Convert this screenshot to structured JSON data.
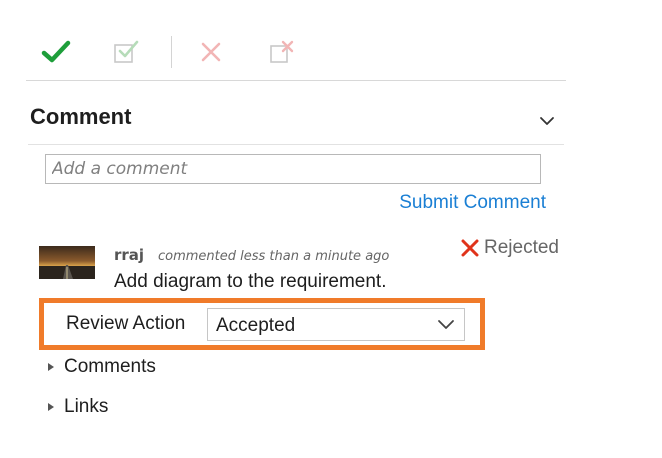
{
  "toolbar": {
    "buttons": [
      {
        "name": "approve",
        "icon": "checkmark-icon",
        "color": "#1e9e3a"
      },
      {
        "name": "approve-with-comment",
        "icon": "check-note-icon",
        "color": "#c8c8c8"
      },
      {
        "name": "reject",
        "icon": "x-icon",
        "color": "#f0b8b8"
      },
      {
        "name": "reject-with-comment",
        "icon": "x-note-icon",
        "color": "#f0b8b8"
      }
    ]
  },
  "comment_section": {
    "title": "Comment",
    "collapse_icon": "chevron-down-icon",
    "input_placeholder": "Add a comment",
    "input_value": "",
    "submit_label": "Submit Comment",
    "link_color": "#1a7fd4"
  },
  "entry": {
    "author": "rraj",
    "meta": "commented less than a minute ago",
    "status": {
      "icon": "x-icon",
      "label": "Rejected",
      "color": "#e0331b"
    },
    "body": "Add diagram to the requirement.",
    "review_action": {
      "label": "Review Action",
      "selected": "Accepted",
      "highlight_color": "#f07b2a"
    }
  },
  "expanders": [
    {
      "label": "Comments"
    },
    {
      "label": "Links"
    }
  ]
}
